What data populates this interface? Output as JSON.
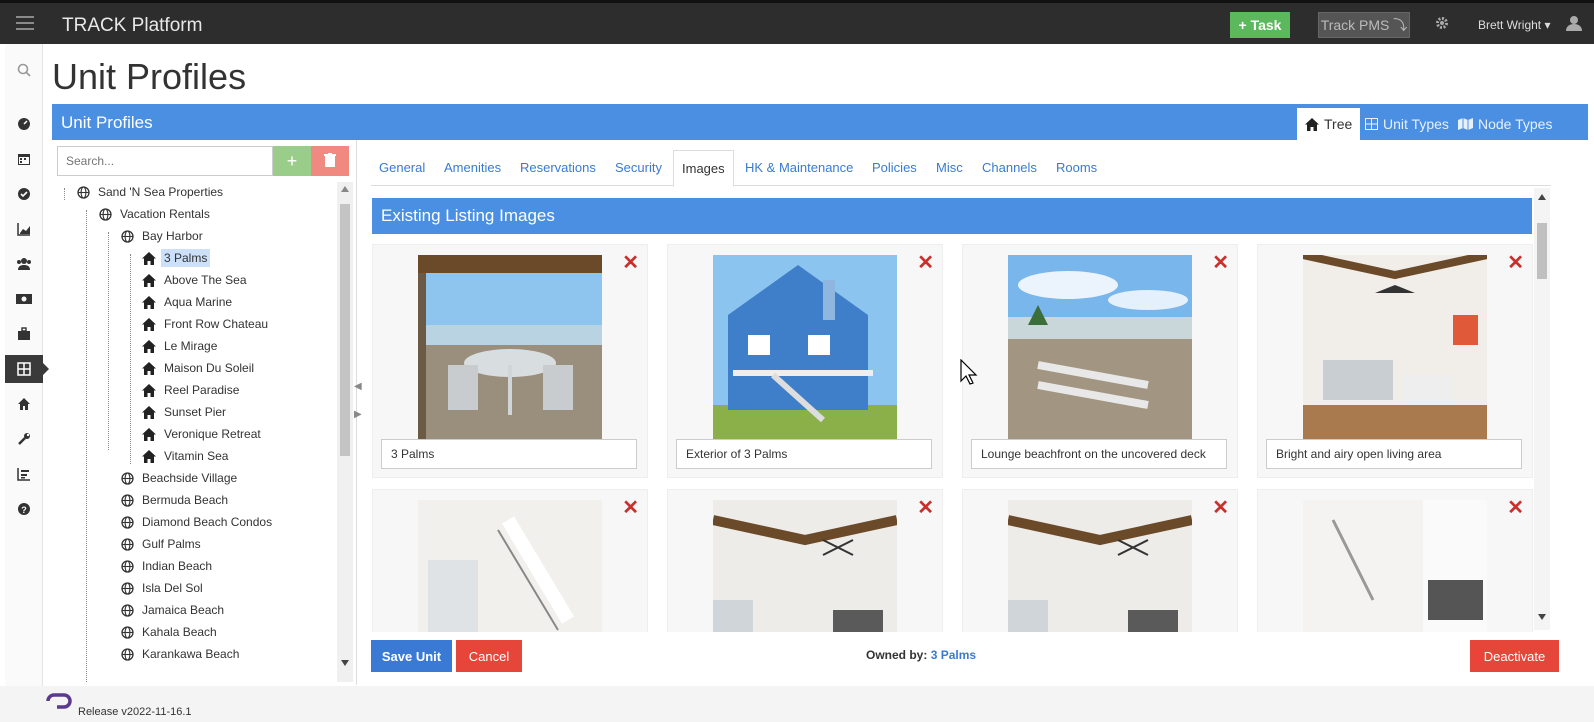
{
  "app": {
    "title": "TRACK Platform"
  },
  "topbar": {
    "task_label": "+ Task",
    "pms_label": "Track PMS ⤵",
    "user_name": "Brett Wright ▾"
  },
  "page": {
    "title": "Unit Profiles"
  },
  "panel": {
    "title": "Unit Profiles",
    "views": [
      "Tree",
      "Unit Types",
      "Node Types"
    ]
  },
  "search": {
    "placeholder": "Search..."
  },
  "tree": {
    "nodes": [
      {
        "label": "Sand 'N Sea Properties",
        "type": "globe"
      },
      {
        "label": "Vacation Rentals",
        "type": "globe"
      },
      {
        "label": "Bay Harbor",
        "type": "globe"
      },
      {
        "label": "3 Palms",
        "type": "home",
        "selected": true
      },
      {
        "label": "Above The Sea",
        "type": "home"
      },
      {
        "label": "Aqua Marine",
        "type": "home"
      },
      {
        "label": "Front Row Chateau",
        "type": "home"
      },
      {
        "label": "Le Mirage",
        "type": "home"
      },
      {
        "label": "Maison Du Soleil",
        "type": "home"
      },
      {
        "label": "Reel Paradise",
        "type": "home"
      },
      {
        "label": "Sunset Pier",
        "type": "home"
      },
      {
        "label": "Veronique Retreat",
        "type": "home"
      },
      {
        "label": "Vitamin Sea",
        "type": "home"
      },
      {
        "label": "Beachside Village",
        "type": "globe"
      },
      {
        "label": "Bermuda Beach",
        "type": "globe"
      },
      {
        "label": "Diamond Beach Condos",
        "type": "globe"
      },
      {
        "label": "Gulf Palms",
        "type": "globe"
      },
      {
        "label": "Indian Beach",
        "type": "globe"
      },
      {
        "label": "Isla Del Sol",
        "type": "globe"
      },
      {
        "label": "Jamaica Beach",
        "type": "globe"
      },
      {
        "label": "Kahala Beach",
        "type": "globe"
      },
      {
        "label": "Karankawa Beach",
        "type": "globe"
      }
    ]
  },
  "tabs": [
    "General",
    "Amenities",
    "Reservations",
    "Security",
    "Images",
    "HK & Maintenance",
    "Policies",
    "Misc",
    "Channels",
    "Rooms"
  ],
  "images": {
    "header": "Existing Listing Images",
    "items": [
      {
        "caption": "3 Palms",
        "scene": "deck"
      },
      {
        "caption": "Exterior of 3 Palms",
        "scene": "house"
      },
      {
        "caption": "Lounge beachfront on the uncovered deck",
        "scene": "beach"
      },
      {
        "caption": "Bright and airy open living area",
        "scene": "living"
      },
      {
        "caption": "",
        "scene": "stairs"
      },
      {
        "caption": "",
        "scene": "room"
      },
      {
        "caption": "",
        "scene": "room"
      },
      {
        "caption": "",
        "scene": "kitchen"
      }
    ]
  },
  "actions": {
    "save_label": "Save Unit",
    "cancel_label": "Cancel",
    "deactivate_label": "Deactivate",
    "owned_label": "Owned by:",
    "owned_value": "3 Palms"
  },
  "footer": {
    "release": "Release v2022-11-16.1"
  },
  "colors": {
    "accent": "#4a8fe2",
    "success": "#5cb85c",
    "danger": "#e6463a",
    "topbar": "#2d2d2d"
  }
}
